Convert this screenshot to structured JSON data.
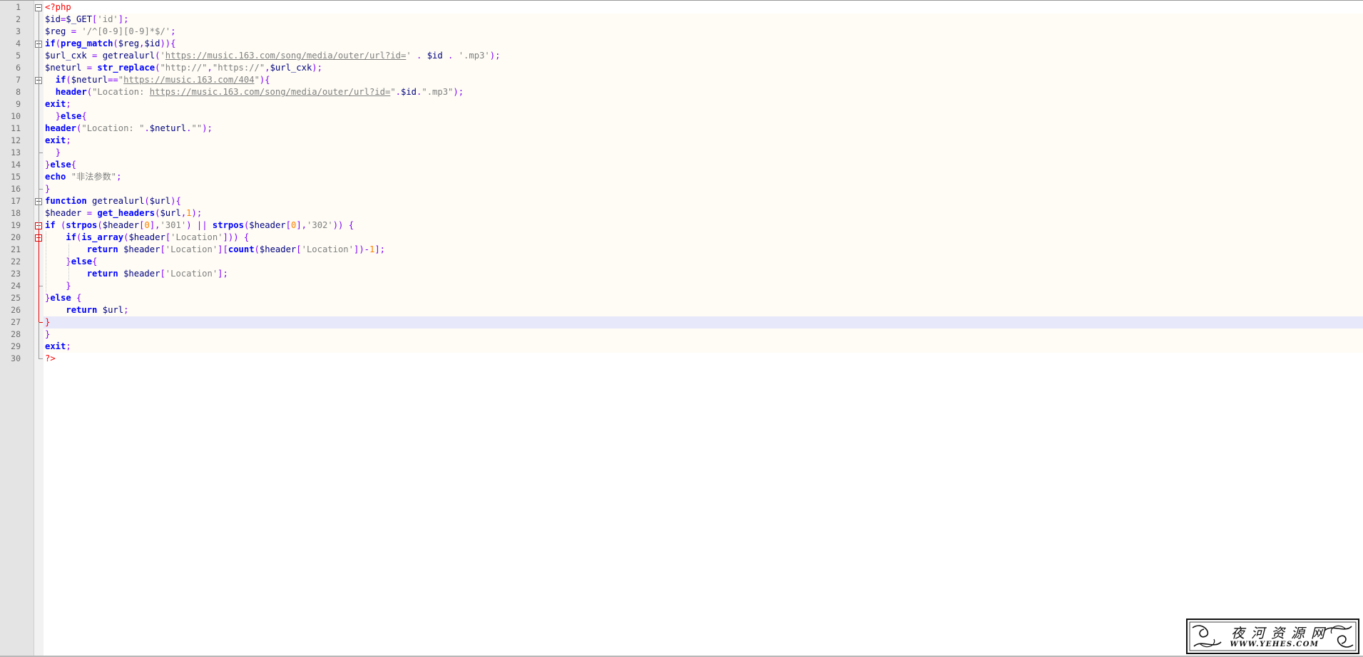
{
  "editor": {
    "line_numbers": [
      "1",
      "2",
      "3",
      "4",
      "5",
      "6",
      "7",
      "8",
      "9",
      "10",
      "11",
      "12",
      "13",
      "14",
      "15",
      "16",
      "17",
      "18",
      "19",
      "20",
      "21",
      "22",
      "23",
      "24",
      "25",
      "26",
      "27",
      "28",
      "29",
      "30"
    ],
    "colors": {
      "keyword": "#0000ff",
      "string": "#808080",
      "number": "#ff8000",
      "variable": "#000080",
      "operator": "#8000ff",
      "php_tag": "#ff0000",
      "current_line": "#e8e8fb",
      "php_background": "#fefcf4"
    },
    "lines": [
      [
        [
          "<?php",
          "tag"
        ]
      ],
      [
        [
          "$id",
          "var"
        ],
        [
          "=",
          "op"
        ],
        [
          "$_GET",
          "var"
        ],
        [
          "[",
          "op"
        ],
        [
          "'id'",
          "str"
        ],
        [
          "];",
          "op"
        ]
      ],
      [
        [
          "$reg",
          "var"
        ],
        [
          " ",
          "var"
        ],
        [
          "=",
          "op"
        ],
        [
          " ",
          "var"
        ],
        [
          "'/^[0-9][0-9]*$/'",
          "str"
        ],
        [
          ";",
          "op"
        ]
      ],
      [
        [
          "if",
          "kw"
        ],
        [
          "(",
          "op"
        ],
        [
          "preg_match",
          "kw"
        ],
        [
          "(",
          "op"
        ],
        [
          "$reg",
          "var"
        ],
        [
          ",",
          "op"
        ],
        [
          "$id",
          "var"
        ],
        [
          "))",
          "op"
        ],
        [
          "{",
          "op"
        ]
      ],
      [
        [
          "$url_cxk",
          "var"
        ],
        [
          " ",
          "var"
        ],
        [
          "=",
          "op"
        ],
        [
          " getrealurl",
          "fn"
        ],
        [
          "(",
          "op"
        ],
        [
          "'",
          "str"
        ],
        [
          "https://music.163.com/song/media/outer/url?id=",
          "url"
        ],
        [
          "'",
          "str"
        ],
        [
          " . ",
          "op"
        ],
        [
          "$id",
          "var"
        ],
        [
          " . ",
          "op"
        ],
        [
          "'.mp3'",
          "str"
        ],
        [
          ");",
          "op"
        ]
      ],
      [
        [
          "$neturl",
          "var"
        ],
        [
          " ",
          "var"
        ],
        [
          "=",
          "op"
        ],
        [
          " ",
          "var"
        ],
        [
          "str_replace",
          "kw"
        ],
        [
          "(",
          "op"
        ],
        [
          "\"http://\"",
          "str"
        ],
        [
          ",",
          "op"
        ],
        [
          "\"https://\"",
          "str"
        ],
        [
          ",",
          "op"
        ],
        [
          "$url_cxk",
          "var"
        ],
        [
          ");",
          "op"
        ]
      ],
      [
        [
          "  ",
          "var"
        ],
        [
          "if",
          "kw"
        ],
        [
          "(",
          "op"
        ],
        [
          "$neturl",
          "var"
        ],
        [
          "==",
          "op"
        ],
        [
          "\"",
          "str"
        ],
        [
          "https://music.163.com/404",
          "url"
        ],
        [
          "\"",
          "str"
        ],
        [
          ")",
          "op"
        ],
        [
          "{",
          "op"
        ]
      ],
      [
        [
          "  ",
          "var"
        ],
        [
          "header",
          "kw"
        ],
        [
          "(",
          "op"
        ],
        [
          "\"Location: ",
          "str"
        ],
        [
          "https://music.163.com/song/media/outer/url?id=",
          "url"
        ],
        [
          "\"",
          "str"
        ],
        [
          ".",
          "op"
        ],
        [
          "$id",
          "var"
        ],
        [
          ".",
          "op"
        ],
        [
          "\".mp3\"",
          "str"
        ],
        [
          ");",
          "op"
        ]
      ],
      [
        [
          "exit",
          "kw"
        ],
        [
          ";",
          "op"
        ]
      ],
      [
        [
          "  ",
          "var"
        ],
        [
          "}",
          "op"
        ],
        [
          "else",
          "kw"
        ],
        [
          "{",
          "op"
        ]
      ],
      [
        [
          "header",
          "kw"
        ],
        [
          "(",
          "op"
        ],
        [
          "\"Location: \"",
          "str"
        ],
        [
          ".",
          "op"
        ],
        [
          "$neturl",
          "var"
        ],
        [
          ".",
          "op"
        ],
        [
          "\"\"",
          "str"
        ],
        [
          ");",
          "op"
        ]
      ],
      [
        [
          "exit",
          "kw"
        ],
        [
          ";",
          "op"
        ]
      ],
      [
        [
          "  ",
          "var"
        ],
        [
          "}",
          "op"
        ]
      ],
      [
        [
          "}",
          "op"
        ],
        [
          "else",
          "kw"
        ],
        [
          "{",
          "op"
        ]
      ],
      [
        [
          "echo",
          "kw"
        ],
        [
          " ",
          "var"
        ],
        [
          "\"非法参数\"",
          "str"
        ],
        [
          ";",
          "op"
        ]
      ],
      [
        [
          "}",
          "op"
        ]
      ],
      [
        [
          "function",
          "kw"
        ],
        [
          " getrealurl",
          "fn"
        ],
        [
          "(",
          "op"
        ],
        [
          "$url",
          "var"
        ],
        [
          ")",
          "op"
        ],
        [
          "{",
          "op"
        ]
      ],
      [
        [
          "$header",
          "var"
        ],
        [
          " ",
          "var"
        ],
        [
          "=",
          "op"
        ],
        [
          " ",
          "var"
        ],
        [
          "get_headers",
          "kw"
        ],
        [
          "(",
          "op"
        ],
        [
          "$url",
          "var"
        ],
        [
          ",",
          "op"
        ],
        [
          "1",
          "num"
        ],
        [
          ");",
          "op"
        ]
      ],
      [
        [
          "if",
          "kw"
        ],
        [
          " ",
          "var"
        ],
        [
          "(",
          "op"
        ],
        [
          "strpos",
          "kw"
        ],
        [
          "(",
          "op"
        ],
        [
          "$header",
          "var"
        ],
        [
          "[",
          "op"
        ],
        [
          "0",
          "num"
        ],
        [
          "],",
          "op"
        ],
        [
          "'301'",
          "str"
        ],
        [
          ")",
          "op"
        ],
        [
          " ",
          "var"
        ],
        [
          "||",
          "op"
        ],
        [
          " ",
          "var"
        ],
        [
          "strpos",
          "kw"
        ],
        [
          "(",
          "op"
        ],
        [
          "$header",
          "var"
        ],
        [
          "[",
          "op"
        ],
        [
          "0",
          "num"
        ],
        [
          "],",
          "op"
        ],
        [
          "'302'",
          "str"
        ],
        [
          "))",
          "op"
        ],
        [
          " ",
          "var"
        ],
        [
          "{",
          "op"
        ]
      ],
      [
        [
          "    ",
          "var"
        ],
        [
          "if",
          "kw"
        ],
        [
          "(",
          "op"
        ],
        [
          "is_array",
          "kw"
        ],
        [
          "(",
          "op"
        ],
        [
          "$header",
          "var"
        ],
        [
          "[",
          "op"
        ],
        [
          "'Location'",
          "str"
        ],
        [
          "]))",
          "op"
        ],
        [
          " ",
          "var"
        ],
        [
          "{",
          "op"
        ]
      ],
      [
        [
          "        ",
          "var"
        ],
        [
          "return",
          "kw"
        ],
        [
          " ",
          "var"
        ],
        [
          "$header",
          "var"
        ],
        [
          "[",
          "op"
        ],
        [
          "'Location'",
          "str"
        ],
        [
          "][",
          "op"
        ],
        [
          "count",
          "kw"
        ],
        [
          "(",
          "op"
        ],
        [
          "$header",
          "var"
        ],
        [
          "[",
          "op"
        ],
        [
          "'Location'",
          "str"
        ],
        [
          "])-",
          "op"
        ],
        [
          "1",
          "num"
        ],
        [
          "];",
          "op"
        ]
      ],
      [
        [
          "    ",
          "var"
        ],
        [
          "}",
          "op"
        ],
        [
          "else",
          "kw"
        ],
        [
          "{",
          "op"
        ]
      ],
      [
        [
          "        ",
          "var"
        ],
        [
          "return",
          "kw"
        ],
        [
          " ",
          "var"
        ],
        [
          "$header",
          "var"
        ],
        [
          "[",
          "op"
        ],
        [
          "'Location'",
          "str"
        ],
        [
          "];",
          "op"
        ]
      ],
      [
        [
          "    ",
          "var"
        ],
        [
          "}",
          "op"
        ]
      ],
      [
        [
          "}",
          "op"
        ],
        [
          "else",
          "kw"
        ],
        [
          " ",
          "var"
        ],
        [
          "{",
          "op"
        ]
      ],
      [
        [
          "    ",
          "var"
        ],
        [
          "return",
          "kw"
        ],
        [
          " ",
          "var"
        ],
        [
          "$url",
          "var"
        ],
        [
          ";",
          "op"
        ]
      ],
      [
        [
          "}",
          "tag"
        ]
      ],
      [
        [
          "}",
          "op"
        ]
      ],
      [
        [
          "exit",
          "kw"
        ],
        [
          ";",
          "op"
        ]
      ],
      [
        [
          "?>",
          "tag"
        ]
      ]
    ]
  },
  "watermark": {
    "title": "夜河资源网",
    "url": "WWW.YEHES.COM"
  }
}
